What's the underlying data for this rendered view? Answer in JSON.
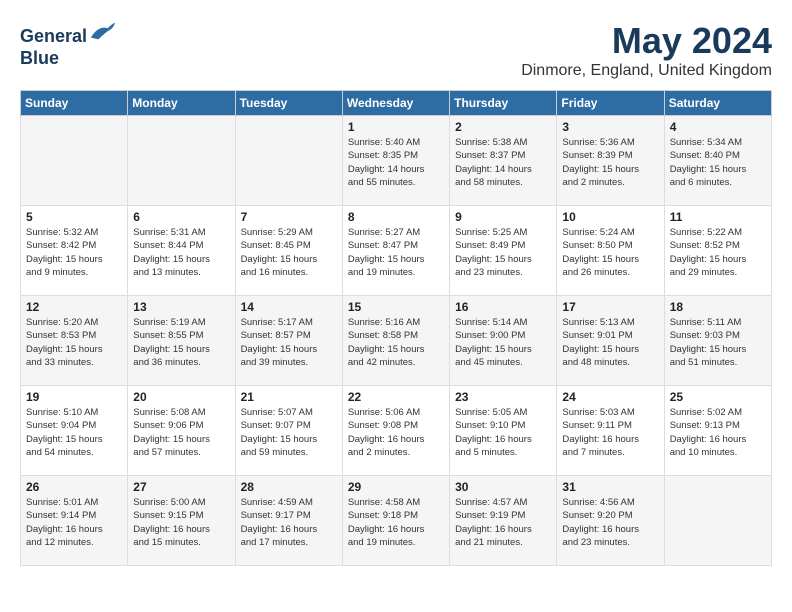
{
  "header": {
    "logo_line1": "General",
    "logo_line2": "Blue",
    "title": "May 2024",
    "subtitle": "Dinmore, England, United Kingdom"
  },
  "days_of_week": [
    "Sunday",
    "Monday",
    "Tuesday",
    "Wednesday",
    "Thursday",
    "Friday",
    "Saturday"
  ],
  "weeks": [
    [
      {
        "day": "",
        "info": ""
      },
      {
        "day": "",
        "info": ""
      },
      {
        "day": "",
        "info": ""
      },
      {
        "day": "1",
        "info": "Sunrise: 5:40 AM\nSunset: 8:35 PM\nDaylight: 14 hours\nand 55 minutes."
      },
      {
        "day": "2",
        "info": "Sunrise: 5:38 AM\nSunset: 8:37 PM\nDaylight: 14 hours\nand 58 minutes."
      },
      {
        "day": "3",
        "info": "Sunrise: 5:36 AM\nSunset: 8:39 PM\nDaylight: 15 hours\nand 2 minutes."
      },
      {
        "day": "4",
        "info": "Sunrise: 5:34 AM\nSunset: 8:40 PM\nDaylight: 15 hours\nand 6 minutes."
      }
    ],
    [
      {
        "day": "5",
        "info": "Sunrise: 5:32 AM\nSunset: 8:42 PM\nDaylight: 15 hours\nand 9 minutes."
      },
      {
        "day": "6",
        "info": "Sunrise: 5:31 AM\nSunset: 8:44 PM\nDaylight: 15 hours\nand 13 minutes."
      },
      {
        "day": "7",
        "info": "Sunrise: 5:29 AM\nSunset: 8:45 PM\nDaylight: 15 hours\nand 16 minutes."
      },
      {
        "day": "8",
        "info": "Sunrise: 5:27 AM\nSunset: 8:47 PM\nDaylight: 15 hours\nand 19 minutes."
      },
      {
        "day": "9",
        "info": "Sunrise: 5:25 AM\nSunset: 8:49 PM\nDaylight: 15 hours\nand 23 minutes."
      },
      {
        "day": "10",
        "info": "Sunrise: 5:24 AM\nSunset: 8:50 PM\nDaylight: 15 hours\nand 26 minutes."
      },
      {
        "day": "11",
        "info": "Sunrise: 5:22 AM\nSunset: 8:52 PM\nDaylight: 15 hours\nand 29 minutes."
      }
    ],
    [
      {
        "day": "12",
        "info": "Sunrise: 5:20 AM\nSunset: 8:53 PM\nDaylight: 15 hours\nand 33 minutes."
      },
      {
        "day": "13",
        "info": "Sunrise: 5:19 AM\nSunset: 8:55 PM\nDaylight: 15 hours\nand 36 minutes."
      },
      {
        "day": "14",
        "info": "Sunrise: 5:17 AM\nSunset: 8:57 PM\nDaylight: 15 hours\nand 39 minutes."
      },
      {
        "day": "15",
        "info": "Sunrise: 5:16 AM\nSunset: 8:58 PM\nDaylight: 15 hours\nand 42 minutes."
      },
      {
        "day": "16",
        "info": "Sunrise: 5:14 AM\nSunset: 9:00 PM\nDaylight: 15 hours\nand 45 minutes."
      },
      {
        "day": "17",
        "info": "Sunrise: 5:13 AM\nSunset: 9:01 PM\nDaylight: 15 hours\nand 48 minutes."
      },
      {
        "day": "18",
        "info": "Sunrise: 5:11 AM\nSunset: 9:03 PM\nDaylight: 15 hours\nand 51 minutes."
      }
    ],
    [
      {
        "day": "19",
        "info": "Sunrise: 5:10 AM\nSunset: 9:04 PM\nDaylight: 15 hours\nand 54 minutes."
      },
      {
        "day": "20",
        "info": "Sunrise: 5:08 AM\nSunset: 9:06 PM\nDaylight: 15 hours\nand 57 minutes."
      },
      {
        "day": "21",
        "info": "Sunrise: 5:07 AM\nSunset: 9:07 PM\nDaylight: 15 hours\nand 59 minutes."
      },
      {
        "day": "22",
        "info": "Sunrise: 5:06 AM\nSunset: 9:08 PM\nDaylight: 16 hours\nand 2 minutes."
      },
      {
        "day": "23",
        "info": "Sunrise: 5:05 AM\nSunset: 9:10 PM\nDaylight: 16 hours\nand 5 minutes."
      },
      {
        "day": "24",
        "info": "Sunrise: 5:03 AM\nSunset: 9:11 PM\nDaylight: 16 hours\nand 7 minutes."
      },
      {
        "day": "25",
        "info": "Sunrise: 5:02 AM\nSunset: 9:13 PM\nDaylight: 16 hours\nand 10 minutes."
      }
    ],
    [
      {
        "day": "26",
        "info": "Sunrise: 5:01 AM\nSunset: 9:14 PM\nDaylight: 16 hours\nand 12 minutes."
      },
      {
        "day": "27",
        "info": "Sunrise: 5:00 AM\nSunset: 9:15 PM\nDaylight: 16 hours\nand 15 minutes."
      },
      {
        "day": "28",
        "info": "Sunrise: 4:59 AM\nSunset: 9:17 PM\nDaylight: 16 hours\nand 17 minutes."
      },
      {
        "day": "29",
        "info": "Sunrise: 4:58 AM\nSunset: 9:18 PM\nDaylight: 16 hours\nand 19 minutes."
      },
      {
        "day": "30",
        "info": "Sunrise: 4:57 AM\nSunset: 9:19 PM\nDaylight: 16 hours\nand 21 minutes."
      },
      {
        "day": "31",
        "info": "Sunrise: 4:56 AM\nSunset: 9:20 PM\nDaylight: 16 hours\nand 23 minutes."
      },
      {
        "day": "",
        "info": ""
      }
    ]
  ]
}
